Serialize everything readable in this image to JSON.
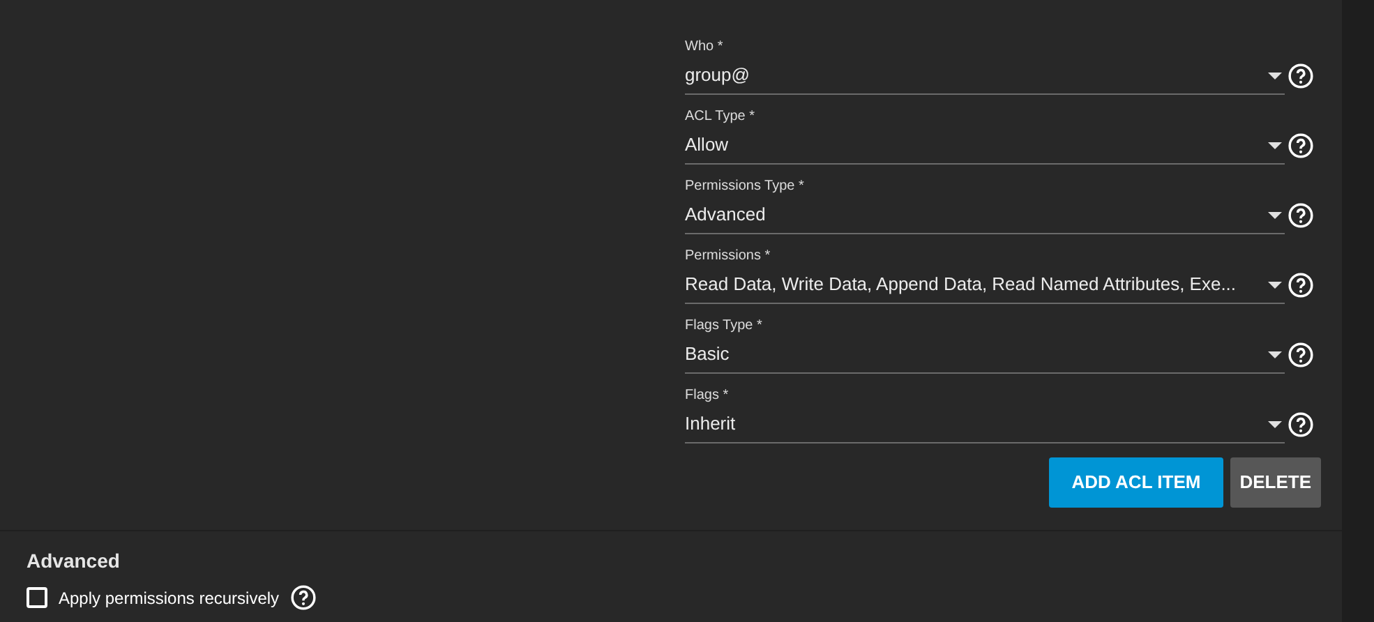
{
  "fields": [
    {
      "label": "Who *",
      "value": "group@"
    },
    {
      "label": "ACL Type *",
      "value": "Allow"
    },
    {
      "label": "Permissions Type *",
      "value": "Advanced"
    },
    {
      "label": "Permissions *",
      "value": "Read Data, Write Data, Append Data, Read Named Attributes, Exe..."
    },
    {
      "label": "Flags Type *",
      "value": "Basic"
    },
    {
      "label": "Flags *",
      "value": "Inherit"
    }
  ],
  "buttons": [
    {
      "label": "ADD ACL ITEM",
      "kind": "primary"
    },
    {
      "label": "DELETE",
      "kind": "secondary"
    }
  ],
  "advanced": {
    "title": "Advanced",
    "options": [
      {
        "label": "Apply permissions recursively",
        "checked": false
      }
    ]
  }
}
